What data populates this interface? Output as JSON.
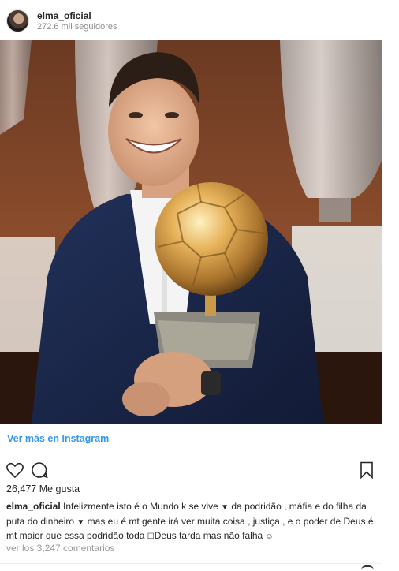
{
  "post": {
    "username": "elma_oficial",
    "followers": "272.6 mil seguidores",
    "see_more": "Ver más en Instagram",
    "likes": "26,477 Me gusta",
    "caption_user": "elma_oficial",
    "caption_text": " Infelizmente isto é o Mundo k se vive ",
    "caption_part2": " da podridão , máfia e do filha da puta do dinheiro ",
    "caption_part3": " mas eu é mt gente irá ver muita coisa , justiça , e o poder de Deus é mt maior que essa podridão toda ",
    "caption_part4": "Deus tarda mas não falha ",
    "comments": "ver los 3,247 comentarios"
  },
  "icons": {
    "like": "heart-icon",
    "comment": "comment-icon",
    "save": "bookmark-icon"
  },
  "colors": {
    "link": "#3897f0",
    "muted": "#8e8e8e",
    "text": "#262626"
  }
}
